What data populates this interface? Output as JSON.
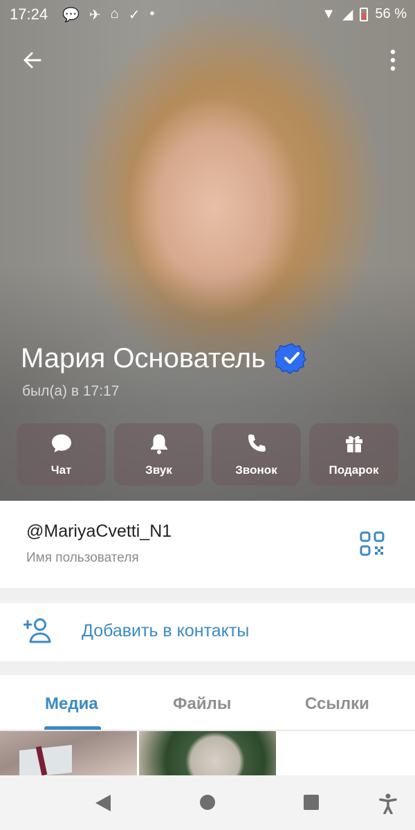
{
  "status_bar": {
    "time": "17:24",
    "battery": "56 %"
  },
  "profile": {
    "name": "Мария Основатель",
    "last_seen": "был(а) в 17:17"
  },
  "actions": [
    {
      "label": "Чат",
      "icon": "chat-bubble-icon"
    },
    {
      "label": "Звук",
      "icon": "bell-icon"
    },
    {
      "label": "Звонок",
      "icon": "phone-icon"
    },
    {
      "label": "Подарок",
      "icon": "gift-icon"
    }
  ],
  "user_info": {
    "username": "@MariyaCvetti_N1",
    "username_caption": "Имя пользователя"
  },
  "add_contact": {
    "label": "Добавить в контакты"
  },
  "tabs": [
    {
      "label": "Медиа",
      "active": true
    },
    {
      "label": "Файлы",
      "active": false
    },
    {
      "label": "Ссылки",
      "active": false
    }
  ],
  "colors": {
    "accent": "#3a8ac4",
    "verified": "#2f6df0"
  }
}
